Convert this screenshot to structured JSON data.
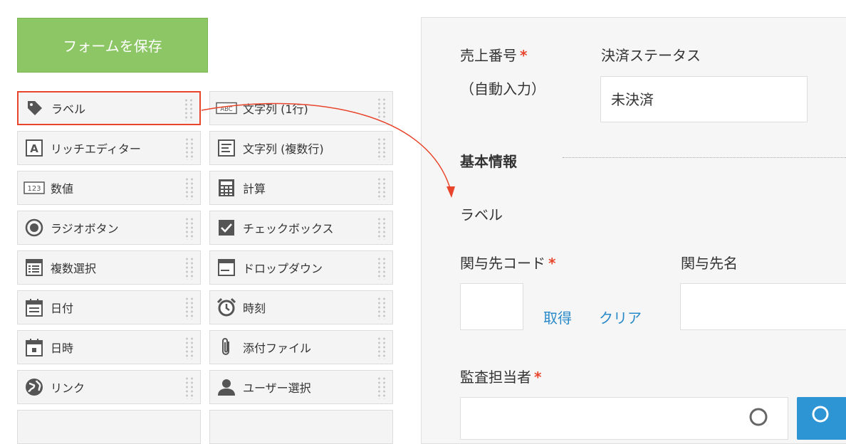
{
  "toolbar": {
    "save_label": "フォームを保存"
  },
  "palette": [
    {
      "label": "ラベル",
      "icon": "tag-icon"
    },
    {
      "label": "文字列 (1行)",
      "icon": "text-abc-icon"
    },
    {
      "label": "リッチエディター",
      "icon": "rich-editor-icon"
    },
    {
      "label": "文字列 (複数行)",
      "icon": "multiline-text-icon"
    },
    {
      "label": "数値",
      "icon": "number-123-icon"
    },
    {
      "label": "計算",
      "icon": "calculator-icon"
    },
    {
      "label": "ラジオボタン",
      "icon": "radio-icon"
    },
    {
      "label": "チェックボックス",
      "icon": "checkbox-icon"
    },
    {
      "label": "複数選択",
      "icon": "multiselect-icon"
    },
    {
      "label": "ドロップダウン",
      "icon": "dropdown-icon"
    },
    {
      "label": "日付",
      "icon": "date-icon"
    },
    {
      "label": "時刻",
      "icon": "clock-icon"
    },
    {
      "label": "日時",
      "icon": "datetime-icon"
    },
    {
      "label": "添付ファイル",
      "icon": "paperclip-icon"
    },
    {
      "label": "リンク",
      "icon": "globe-icon"
    },
    {
      "label": "ユーザー選択",
      "icon": "user-icon"
    }
  ],
  "form": {
    "sales_no_label": "売上番号",
    "sales_no_note": "（自動入力）",
    "payment_status_label": "決済ステータス",
    "payment_status_value": "未決済",
    "section_title": "基本情報",
    "new_label": "ラベル",
    "client_code_label": "関与先コード",
    "fetch_link": "取得",
    "clear_link": "クリア",
    "client_name_label": "関与先名",
    "auditor_label": "監査担当者",
    "required_mark": "*"
  },
  "colors": {
    "accent_green": "#8cc665",
    "required_red": "#e8452c",
    "link_blue": "#2a8ac9"
  }
}
